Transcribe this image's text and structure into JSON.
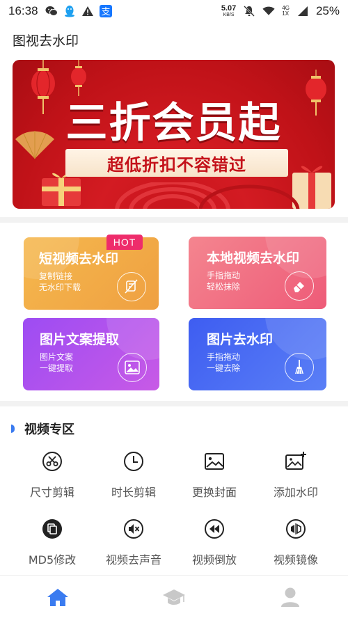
{
  "status_bar": {
    "time": "16:38",
    "net_speed_value": "5.07",
    "net_speed_unit": "KB/S",
    "signal_label_top": "4G",
    "signal_label_bottom": "1X",
    "battery": "25%",
    "left_icons": [
      "wechat-icon",
      "qq-icon",
      "warning-icon",
      "alipay-icon"
    ],
    "right_icons": [
      "mute-icon",
      "wifi-icon",
      "cell-signal-icon",
      "battery-icon"
    ]
  },
  "header": {
    "title": "图视去水印"
  },
  "banner": {
    "headline": "三折会员起",
    "subheadline": "超低折扣不容错过",
    "colors": {
      "background": "#c4121a",
      "strip": "#fff4e6",
      "text": "#ffffff"
    }
  },
  "cards": [
    {
      "title": "短视频去水印",
      "desc_line1": "复制链接",
      "desc_line2": "无水印下载",
      "icon": "no-watermark-icon",
      "badge": "HOT",
      "color_from": "#f5b54a",
      "color_to": "#f0963a"
    },
    {
      "title": "本地视频去水印",
      "desc_line1": "手指拖动",
      "desc_line2": "轻松抹除",
      "icon": "eraser-icon",
      "color_from": "#f47a8a",
      "color_to": "#ef5a78"
    },
    {
      "title": "图片文案提取",
      "desc_line1": "图片文案",
      "desc_line2": "一键提取",
      "icon": "image-icon",
      "color_from": "#a24cf0",
      "color_to": "#c85ce8"
    },
    {
      "title": "图片去水印",
      "desc_line1": "手指拖动",
      "desc_line2": "一键去除",
      "icon": "broom-icon",
      "color_from": "#3d5ff0",
      "color_to": "#5b7cf5"
    }
  ],
  "video_section": {
    "title": "视频专区",
    "tools": [
      {
        "label": "尺寸剪辑",
        "icon": "scissors-icon"
      },
      {
        "label": "时长剪辑",
        "icon": "clock-icon"
      },
      {
        "label": "更换封面",
        "icon": "cover-image-icon"
      },
      {
        "label": "添加水印",
        "icon": "add-watermark-icon"
      },
      {
        "label": "MD5修改",
        "icon": "md5-copy-icon"
      },
      {
        "label": "视频去声音",
        "icon": "mute-speaker-icon"
      },
      {
        "label": "视频倒放",
        "icon": "rewind-icon"
      },
      {
        "label": "视频镜像",
        "icon": "mirror-icon"
      }
    ]
  },
  "bottom_nav": [
    {
      "name": "home",
      "icon": "home-icon",
      "active": true,
      "color": "#3a7bf0"
    },
    {
      "name": "learn",
      "icon": "graduation-cap-icon",
      "active": false,
      "color": "#c8c8c8"
    },
    {
      "name": "profile",
      "icon": "user-icon",
      "active": false,
      "color": "#c8c8c8"
    }
  ]
}
